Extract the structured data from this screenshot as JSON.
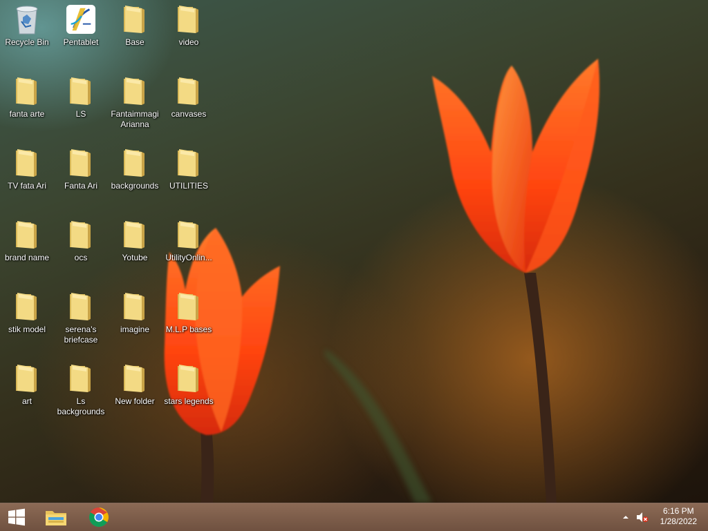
{
  "desktop": {
    "icons": [
      {
        "label": "Recycle Bin",
        "type": "recycle-bin"
      },
      {
        "label": "Pentablet",
        "type": "app"
      },
      {
        "label": "Base",
        "type": "folder"
      },
      {
        "label": "video",
        "type": "folder"
      },
      {
        "label": "fanta arte",
        "type": "folder"
      },
      {
        "label": "LS",
        "type": "folder"
      },
      {
        "label": "Fantaimmagi Arianna",
        "type": "folder"
      },
      {
        "label": "canvases",
        "type": "folder"
      },
      {
        "label": "TV  fata Ari",
        "type": "folder"
      },
      {
        "label": "Fanta Ari",
        "type": "folder"
      },
      {
        "label": "backgrounds",
        "type": "folder"
      },
      {
        "label": "UTILITIES",
        "type": "folder"
      },
      {
        "label": "brand name",
        "type": "folder"
      },
      {
        "label": "ocs",
        "type": "folder"
      },
      {
        "label": "Yotube",
        "type": "folder"
      },
      {
        "label": "UtilityOnlin...",
        "type": "folder"
      },
      {
        "label": "stik  model",
        "type": "folder"
      },
      {
        "label": "serena's briefcase",
        "type": "folder"
      },
      {
        "label": "imagine",
        "type": "folder"
      },
      {
        "label": "M.L.P bases",
        "type": "folder"
      },
      {
        "label": "art",
        "type": "folder"
      },
      {
        "label": "Ls backgrounds",
        "type": "folder"
      },
      {
        "label": "New folder",
        "type": "folder"
      },
      {
        "label": "stars legends",
        "type": "folder"
      }
    ]
  },
  "taskbar": {
    "start_icon": "windows-logo-icon",
    "pinned": [
      "file-explorer-icon",
      "chrome-icon"
    ],
    "tray": {
      "chevron": "show-hidden-icons",
      "volume": "volume-muted-icon"
    },
    "clock": {
      "time": "6:16 PM",
      "date": "1/28/2022"
    }
  },
  "colors": {
    "taskbar": "#7d5e4a",
    "folder": "#f1d77b",
    "tulip": "#ff4a12"
  }
}
